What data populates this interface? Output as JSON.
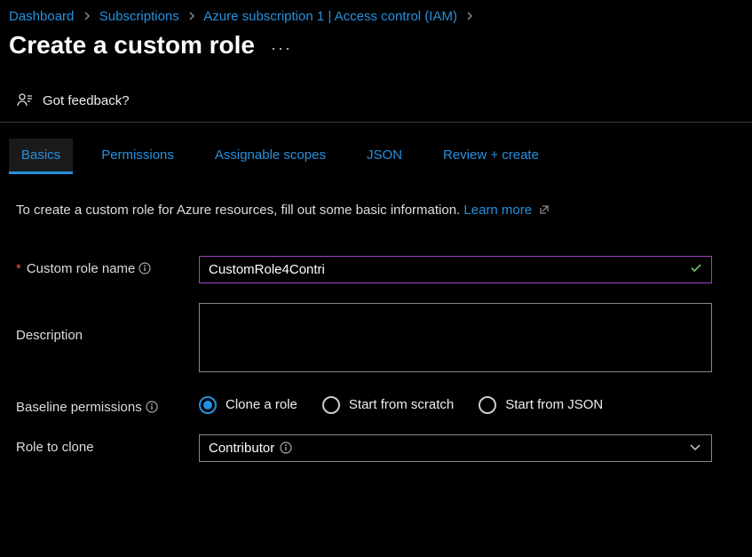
{
  "breadcrumb": {
    "items": [
      {
        "label": "Dashboard"
      },
      {
        "label": "Subscriptions"
      },
      {
        "label": "Azure subscription 1 | Access control (IAM)"
      }
    ]
  },
  "header": {
    "title": "Create a custom role"
  },
  "feedback": {
    "label": "Got feedback?"
  },
  "tabs": [
    {
      "label": "Basics",
      "active": true
    },
    {
      "label": "Permissions",
      "active": false
    },
    {
      "label": "Assignable scopes",
      "active": false
    },
    {
      "label": "JSON",
      "active": false
    },
    {
      "label": "Review + create",
      "active": false
    }
  ],
  "intro": {
    "text": "To create a custom role for Azure resources, fill out some basic information.",
    "learn_more": "Learn more"
  },
  "form": {
    "role_name": {
      "label": "Custom role name",
      "value": "CustomRole4Contri",
      "required": true
    },
    "description": {
      "label": "Description",
      "value": ""
    },
    "baseline": {
      "label": "Baseline permissions",
      "options": [
        {
          "label": "Clone a role",
          "selected": true
        },
        {
          "label": "Start from scratch",
          "selected": false
        },
        {
          "label": "Start from JSON",
          "selected": false
        }
      ]
    },
    "role_to_clone": {
      "label": "Role to clone",
      "value": "Contributor"
    }
  }
}
